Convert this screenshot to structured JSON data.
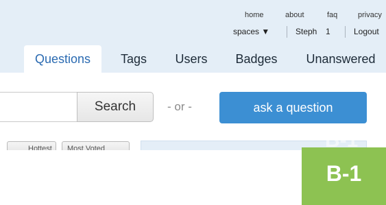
{
  "top_links": {
    "home": "home",
    "about": "about",
    "faq": "faq",
    "privacy": "privacy"
  },
  "account": {
    "spaces": "spaces ▼",
    "user": "Steph",
    "points": "1",
    "logout": "Logout"
  },
  "tabs": [
    {
      "label": "Questions",
      "active": true
    },
    {
      "label": "Tags",
      "active": false
    },
    {
      "label": "Users",
      "active": false
    },
    {
      "label": "Badges",
      "active": false
    },
    {
      "label": "Unanswered",
      "active": false
    }
  ],
  "search": {
    "placeholder": "",
    "button_label": "Search",
    "or_text": "- or -",
    "ask_label": "ask a question"
  },
  "sort_options": [
    "Hottest",
    "Most Voted"
  ],
  "badge": {
    "label": "B-1",
    "ghost_label": "B-1"
  },
  "colors": {
    "header_bg": "#e4eef7",
    "accent": "#3c8fd3",
    "badge_bg": "#8dc252"
  }
}
